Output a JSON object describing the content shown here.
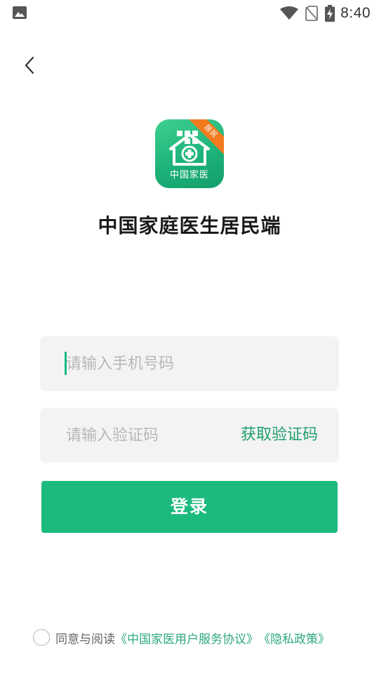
{
  "status_bar": {
    "time": "8:40",
    "icons": [
      "image-icon",
      "wifi-icon",
      "no-sim-icon",
      "battery-charging-icon"
    ]
  },
  "header": {
    "back_icon": "chevron-left-icon"
  },
  "logo": {
    "ribbon_text": "居民",
    "text": "中国家医",
    "colors": {
      "green_start": "#3fd08f",
      "green_end": "#149e6b",
      "ribbon": "#f47a1f"
    }
  },
  "app_title": "中国家庭医生居民端",
  "phone_input": {
    "value": "",
    "placeholder": "请输入手机号码"
  },
  "code_input": {
    "value": "",
    "placeholder": "请输入验证码",
    "get_code_label": "获取验证码"
  },
  "login_button": {
    "label": "登录"
  },
  "agreement": {
    "prefix": "同意与阅读",
    "terms_link": "《中国家医用户服务协议》",
    "privacy_link": "《隐私政策》",
    "checked": false
  },
  "colors": {
    "primary": "#1dba7e",
    "link": "#2ea97c",
    "input_bg": "#f3f3f3"
  }
}
